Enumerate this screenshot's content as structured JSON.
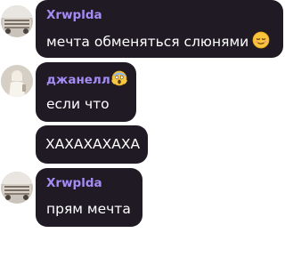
{
  "messages": [
    {
      "author": "Xrwplda",
      "text": "мечта обменяться слюнями",
      "emoji": "relieved-face-emoji",
      "avatar": "avatar-car"
    },
    {
      "author": "джанелл",
      "author_emoji": "scream-face-emoji",
      "text": "если что",
      "avatar": "avatar-person"
    },
    {
      "text": "ХАХАХАХАХА"
    },
    {
      "author": "Xrwplda",
      "text": "прям мечта",
      "avatar": "avatar-car"
    }
  ],
  "colors": {
    "bubble_bg": "#1f1a24",
    "author_name": "#a58cf2",
    "message_text": "#ffffff",
    "page_bg": "#ffffff"
  }
}
